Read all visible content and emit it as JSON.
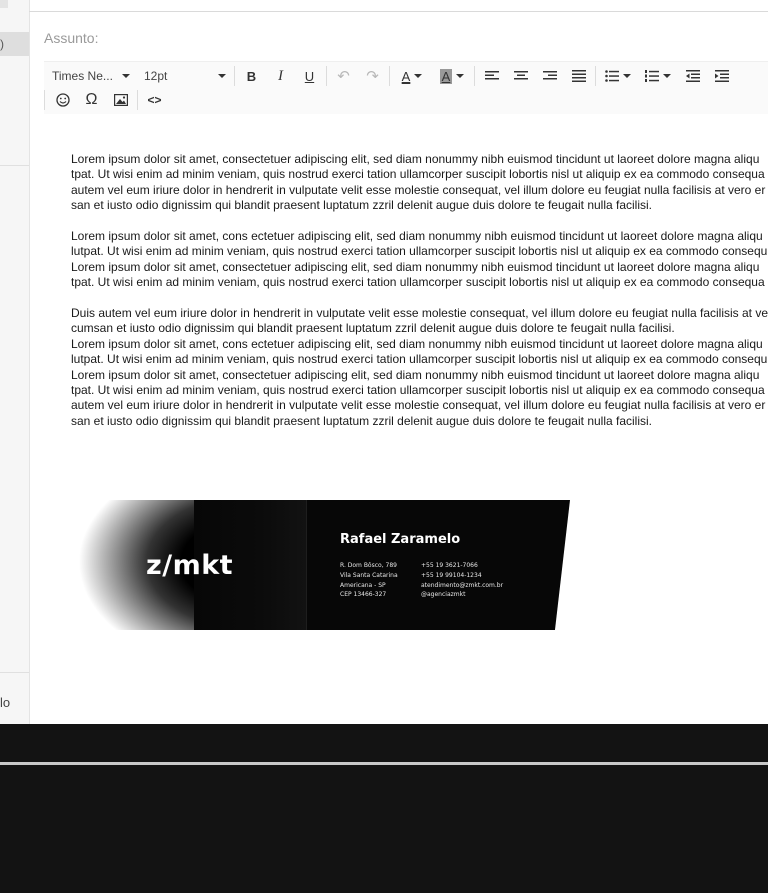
{
  "sidebar": {
    "badge_text": ")",
    "bottom_text": "lo"
  },
  "compose": {
    "subject_placeholder": "Assunto:"
  },
  "toolbar": {
    "font_family": "Times Ne...",
    "font_size": "12pt",
    "bold": "B",
    "italic": "I",
    "underline": "U",
    "undo": "↶",
    "redo": "↷",
    "text_color": "A",
    "bg_color": "A",
    "omega": "Ω",
    "code": "<>"
  },
  "body": {
    "paragraph1": "Lorem ipsum dolor sit amet, consectetuer adipiscing elit, sed diam nonummy nibh euismod tincidunt ut laoreet dolore magna aliqu\ntpat. Ut wisi enim ad minim veniam, quis nostrud exerci tation ullamcorper suscipit lobortis nisl ut aliquip ex ea commodo consequa\nautem vel eum iriure dolor in hendrerit in vulputate velit esse molestie consequat, vel illum dolore eu feugiat nulla facilisis at vero er\nsan et iusto odio dignissim qui blandit praesent luptatum zzril delenit augue duis dolore te feugait nulla facilisi.",
    "paragraph2": "Lorem ipsum dolor sit amet, cons ectetuer adipiscing elit, sed diam nonummy nibh euismod tincidunt ut laoreet dolore magna aliqu\nlutpat. Ut wisi enim ad minim veniam, quis nostrud exerci tation ullamcorper suscipit lobortis nisl ut aliquip ex ea commodo consequ\nLorem ipsum dolor sit amet, consectetuer adipiscing elit, sed diam nonummy nibh euismod tincidunt ut laoreet dolore magna aliqu\ntpat. Ut wisi enim ad minim veniam, quis nostrud exerci tation ullamcorper suscipit lobortis nisl ut aliquip ex ea commodo consequa",
    "paragraph3": "Duis autem vel eum iriure dolor in hendrerit in vulputate velit esse molestie consequat, vel illum dolore eu feugiat nulla facilisis at ve\ncumsan et iusto odio dignissim qui blandit praesent luptatum zzril delenit augue duis dolore te feugait nulla facilisi.\nLorem ipsum dolor sit amet, cons ectetuer adipiscing elit, sed diam nonummy nibh euismod tincidunt ut laoreet dolore magna aliqu\nlutpat. Ut wisi enim ad minim veniam, quis nostrud exerci tation ullamcorper suscipit lobortis nisl ut aliquip ex ea commodo consequ\nLorem ipsum dolor sit amet, consectetuer adipiscing elit, sed diam nonummy nibh euismod tincidunt ut laoreet dolore magna aliqu\ntpat. Ut wisi enim ad minim veniam, quis nostrud exerci tation ullamcorper suscipit lobortis nisl ut aliquip ex ea commodo consequa\nautem vel eum iriure dolor in hendrerit in vulputate velit esse molestie consequat, vel illum dolore eu feugiat nulla facilisis at vero er\nsan et iusto odio dignissim qui blandit praesent luptatum zzril delenit augue duis dolore te feugait nulla facilisi."
  },
  "signature": {
    "logo": "z/mkt",
    "name": "Rafael Zaramelo",
    "address": [
      "R. Dom Bôsco, 789",
      "Vila Santa Catarina",
      "Americana - SP",
      "CEP 13466-327"
    ],
    "contact": [
      "+55 19 3621-7066",
      "+55 19 99104-1234",
      "atendimento@zmkt.com.br",
      "@agenciazmkt"
    ]
  },
  "colors": {
    "signature_bg": "#070707",
    "desktop_bg": "#131313"
  }
}
